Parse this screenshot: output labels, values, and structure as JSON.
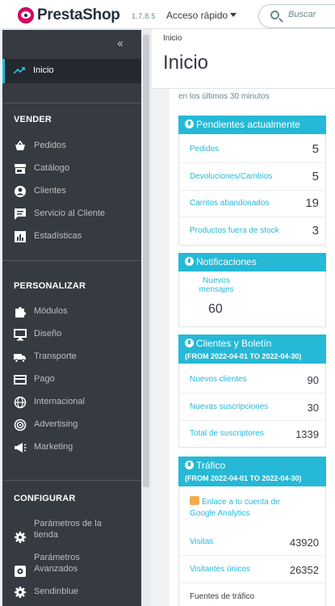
{
  "header": {
    "brand": "PrestaShop",
    "version": "1.7.8.5",
    "quick_access": "Acceso rápido",
    "search_placeholder": "Buscar"
  },
  "sidebar": {
    "collapse_glyph": "‹‹",
    "active": {
      "label": "Inicio",
      "icon": "trending-icon"
    },
    "sections": [
      {
        "title": "VENDER",
        "items": [
          {
            "label": "Pedidos",
            "icon": "cart-icon"
          },
          {
            "label": "Catálogo",
            "icon": "store-icon"
          },
          {
            "label": "Clientes",
            "icon": "person-icon"
          },
          {
            "label": "Servicio al Cliente",
            "icon": "chat-icon"
          },
          {
            "label": "Estadísticas",
            "icon": "chart-icon"
          }
        ]
      },
      {
        "title": "PERSONALIZAR",
        "items": [
          {
            "label": "Módulos",
            "icon": "puzzle-icon"
          },
          {
            "label": "Diseño",
            "icon": "monitor-icon"
          },
          {
            "label": "Transporte",
            "icon": "truck-icon"
          },
          {
            "label": "Pago",
            "icon": "card-icon"
          },
          {
            "label": "Internacional",
            "icon": "globe-icon"
          },
          {
            "label": "Advertising",
            "icon": "target-icon"
          },
          {
            "label": "Marketing",
            "icon": "megaphone-icon"
          }
        ]
      },
      {
        "title": "CONFIGURAR",
        "items": [
          {
            "label_line1": "Parámetros de la",
            "label_line2": "tienda",
            "icon": "gear-icon"
          },
          {
            "label_line1": "Parámetros",
            "label_line2": "Avanzados",
            "icon": "settings-box-icon"
          },
          {
            "label": "Sendinblue",
            "icon": "gear-icon"
          }
        ]
      }
    ]
  },
  "main": {
    "breadcrumb": "Inicio",
    "title": "Inicio",
    "subnote": "en los últimos 30 minutos",
    "pending": {
      "title": "Pendientes actualmente",
      "rows": [
        {
          "label": "Pedidos",
          "value": "5"
        },
        {
          "label": "Devoluciones/Cambios",
          "value": "5"
        },
        {
          "label": "Carritos abandonados",
          "value": "19"
        },
        {
          "label": "Productos fuera de stock",
          "value": "3"
        }
      ]
    },
    "notifications": {
      "title": "Notificaciones",
      "messages_label_1": "Nuevos",
      "messages_label_2": "mensajes",
      "messages_value": "60"
    },
    "customers": {
      "title": "Clientes y Boletín",
      "range": "(FROM 2022-04-01 TO 2022-04-30)",
      "rows": [
        {
          "label": "Nuevos clientes",
          "value": "90"
        },
        {
          "label": "Nuevas suscripciones",
          "value": "30"
        },
        {
          "label": "Total de suscriptores",
          "value": "1339"
        }
      ]
    },
    "traffic": {
      "title": "Tráfico",
      "range": "(FROM 2022-04-01 TO 2022-04-30)",
      "ga_link_1": "Enlace a tu cuenta de",
      "ga_link_2": "Google Analytics",
      "rows": [
        {
          "label": "Visitas",
          "value": "43920"
        },
        {
          "label": "Visitantes únicos",
          "value": "26352"
        }
      ],
      "sources_label": "Fuentes de tráfico"
    }
  },
  "colors": {
    "accent": "#25b9d7",
    "sidebar": "#363a41",
    "brand": "#df0067"
  }
}
